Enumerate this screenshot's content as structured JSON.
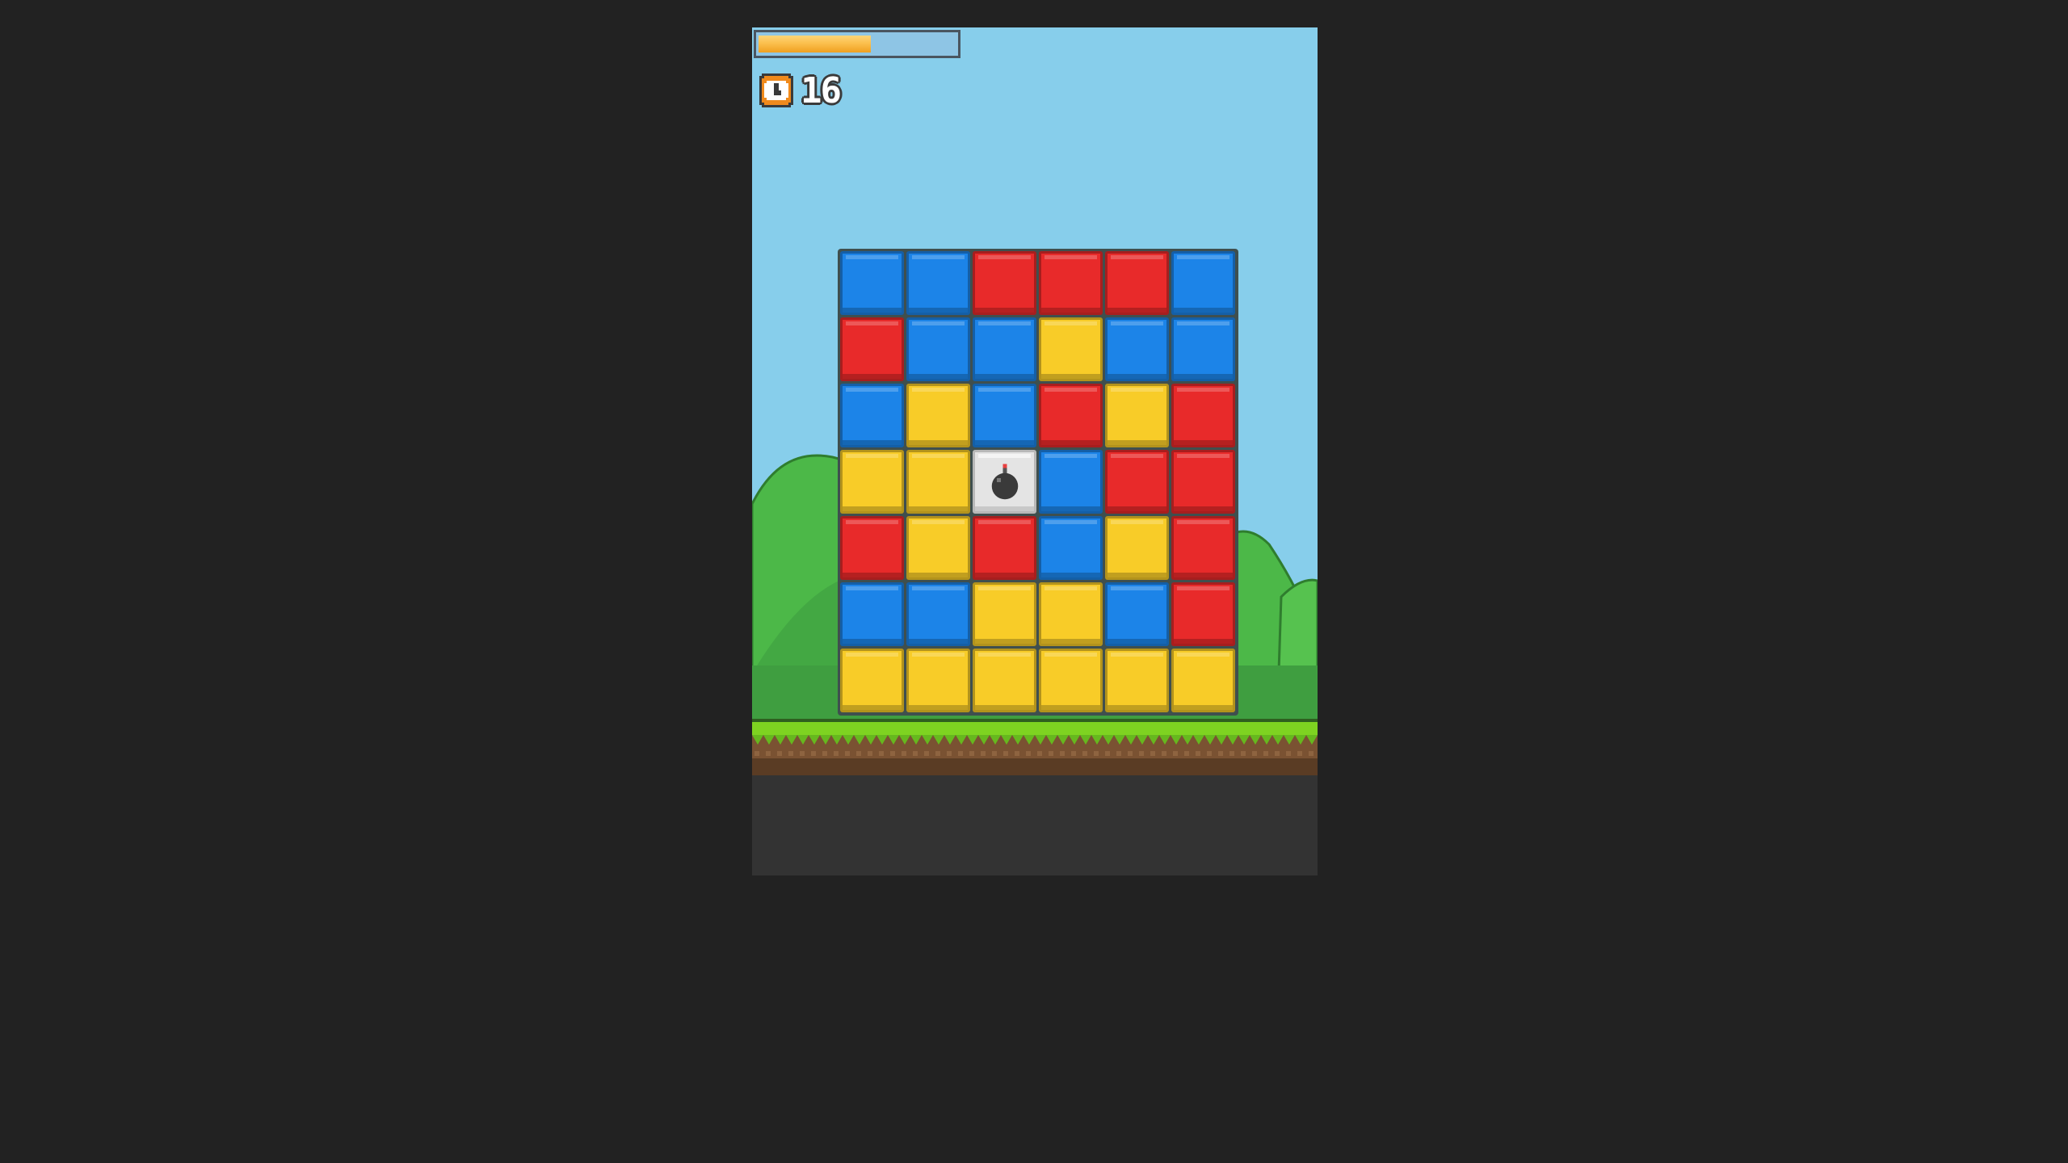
{
  "hud": {
    "progress": 0.57,
    "progress_color": "#f8b433",
    "timer_icon": "clock-icon",
    "timer_value": "16"
  },
  "board": {
    "columns": 6,
    "rows": 7,
    "colors": {
      "blue": "#1c84e8",
      "red": "#e82a2a",
      "yellow": "#f8cc28",
      "bomb": "#e4e4e4"
    },
    "grid": [
      [
        "blue",
        "blue",
        "red",
        "red",
        "red",
        "blue"
      ],
      [
        "red",
        "blue",
        "blue",
        "yellow",
        "blue",
        "blue"
      ],
      [
        "blue",
        "yellow",
        "blue",
        "red",
        "yellow",
        "red"
      ],
      [
        "yellow",
        "yellow",
        "bomb",
        "blue",
        "red",
        "red"
      ],
      [
        "red",
        "yellow",
        "red",
        "blue",
        "yellow",
        "red"
      ],
      [
        "blue",
        "blue",
        "yellow",
        "yellow",
        "blue",
        "red"
      ],
      [
        "yellow",
        "yellow",
        "yellow",
        "yellow",
        "yellow",
        "yellow"
      ]
    ]
  },
  "scene": {
    "sky_color": "#87ceeb",
    "hill_color": "#4cb848",
    "grass_color": "#7ed321",
    "dirt_color": "#7a5232",
    "ground_color": "#333333"
  }
}
